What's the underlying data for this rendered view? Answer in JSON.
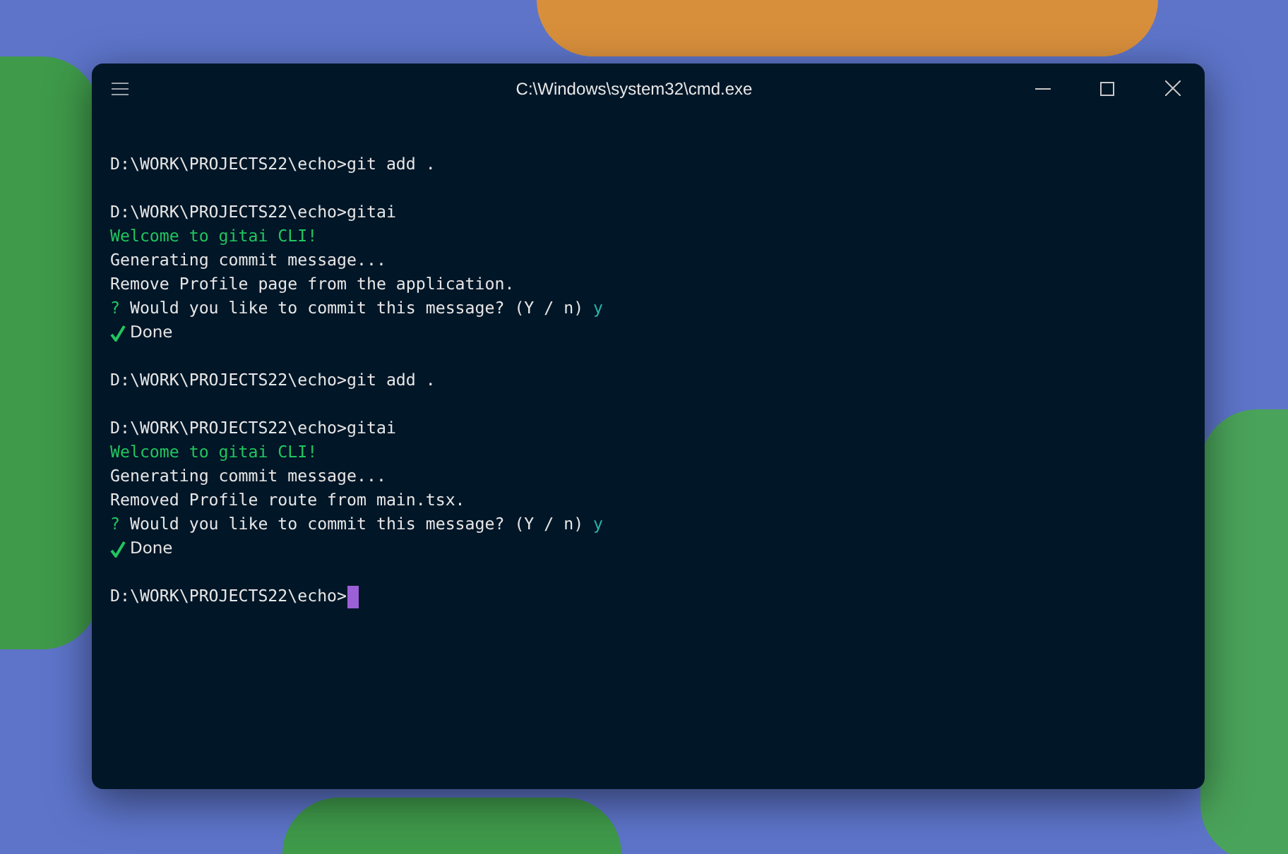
{
  "window": {
    "title": "C:\\Windows\\system32\\cmd.exe"
  },
  "lines": [
    {
      "kind": "command",
      "text": "D:\\WORK\\PROJECTS22\\echo>git add ."
    },
    {
      "kind": "blank"
    },
    {
      "kind": "command",
      "text": "D:\\WORK\\PROJECTS22\\echo>gitai"
    },
    {
      "kind": "success",
      "text": "Welcome to gitai CLI!"
    },
    {
      "kind": "output",
      "text": "Generating commit message..."
    },
    {
      "kind": "output",
      "text": "Remove Profile page from the application."
    },
    {
      "kind": "question",
      "mark": "?",
      "text": "Would you like to commit this message? (Y / n)",
      "answer": "y"
    },
    {
      "kind": "done",
      "text": "Done"
    },
    {
      "kind": "blank"
    },
    {
      "kind": "command",
      "text": "D:\\WORK\\PROJECTS22\\echo>git add ."
    },
    {
      "kind": "blank"
    },
    {
      "kind": "command",
      "text": "D:\\WORK\\PROJECTS22\\echo>gitai"
    },
    {
      "kind": "success",
      "text": "Welcome to gitai CLI!"
    },
    {
      "kind": "output",
      "text": "Generating commit message..."
    },
    {
      "kind": "output",
      "text": "Removed Profile route from main.tsx."
    },
    {
      "kind": "question",
      "mark": "?",
      "text": "Would you like to commit this message? (Y / n)",
      "answer": "y"
    },
    {
      "kind": "done",
      "text": "Done"
    },
    {
      "kind": "blank"
    },
    {
      "kind": "command",
      "text": "D:\\WORK\\PROJECTS22\\echo>",
      "cursor": true
    }
  ]
}
